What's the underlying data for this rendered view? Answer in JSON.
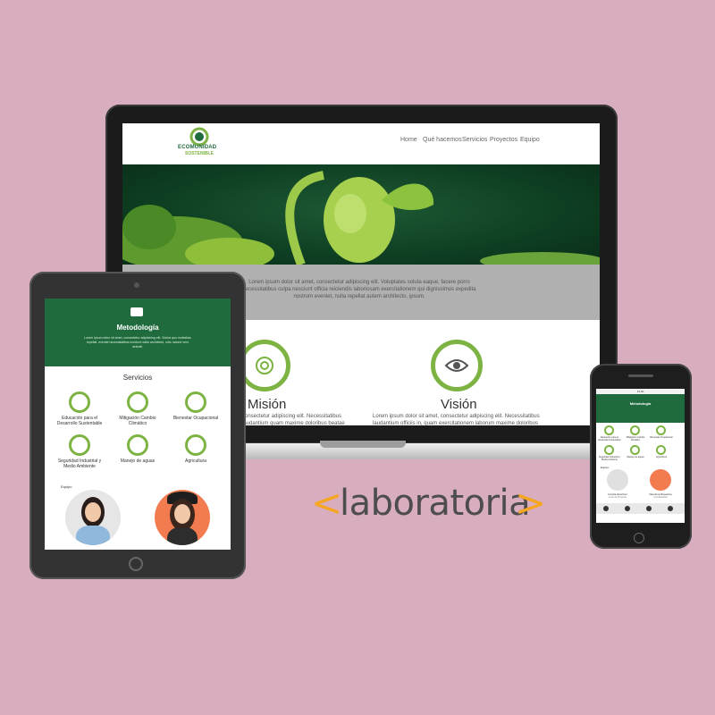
{
  "brand": {
    "name": "ECOMUNIDAD",
    "tagline": "SOSTENIBLE",
    "laboratoria": "laboratoria",
    "laboratoria_left": "<",
    "laboratoria_right": ">"
  },
  "colors": {
    "background": "#d9adc0",
    "green": "#1f6b3e",
    "accent": "#7cb342",
    "orange": "#f5a623"
  },
  "desktop": {
    "nav": [
      "Home",
      "Qué hacemos",
      "Servicios",
      "Proyectos",
      "Equipo"
    ],
    "intro_text": "Lorem ipsum dolor sit amet, consectetur adipiscing elit. Voluptates soluta eaque, facere porro necessitatibus culpa nesciunt officia reiciendis laboriosam exercitationem qui dignissimos expedita nostrum eveniet, nulla repellat autem architecto, ipsum.",
    "mission_title": "Misión",
    "mission_text": "consectetur adipiscing elit. Necessitatibus laudantium quam maxime doloribus beatae iusto officia",
    "vision_title": "Visión",
    "vision_text": "Lorem ipsum dolor sit amet, consectetur adipiscing elit. Necessitatibus laudantium officiis in, quam exercitationem laborum maxime doloribus beatae iusto officia"
  },
  "tablet": {
    "header_title": "Metodología",
    "header_text": "Lorem ipsum dolor sit amet, consectetur adipisicing elit. Soluta quo molestias repellat, eveniet necessitatibus incidunt nobis architecto, odio ratione vero deleniti.",
    "services_title": "Servicios",
    "services": [
      "Educación para el Desarrollo Sustentable",
      "Mitigación Cambio Climático",
      "Bienestar Ocupacional",
      "Seguridad Industrial y Medio Ambiente",
      "Manejo de aguas",
      "Agricultura"
    ],
    "team_label": "Equipo"
  },
  "phone": {
    "status_time": "13:00",
    "header_title": "Metodología",
    "services": [
      "Educación para el Desarrollo Sustentable",
      "Mitigación Cambio Climático",
      "Bienestar Ocupacional",
      "Seguridad Industrial y Medio Ambiente",
      "Manejo de aguas",
      "Agricultura"
    ],
    "team_label": "Equipo",
    "team": [
      {
        "name": "Camila Sanchez",
        "role": "Líder de Proyecto"
      },
      {
        "name": "Valentina Riquelme",
        "role": "Coordinadora"
      }
    ],
    "social_icons": [
      "facebook-icon",
      "twitter-icon",
      "instagram-icon",
      "linkedin-icon"
    ]
  }
}
